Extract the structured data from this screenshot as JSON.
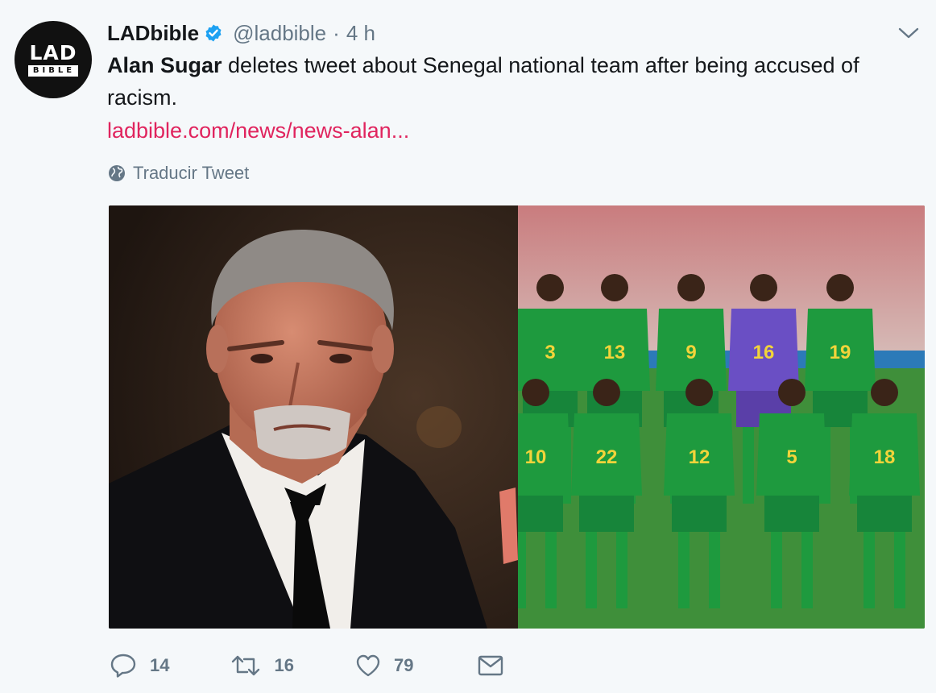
{
  "author": {
    "avatar_line1": "LAD",
    "avatar_line2": "BIBLE",
    "name": "LADbible",
    "handle": "@ladbible",
    "separator": "·",
    "time": "4 h"
  },
  "tweet": {
    "bold_text": "Alan Sugar",
    "text": " deletes tweet about Senegal national team after being accused of racism.",
    "link": "ladbible.com/news/news-alan...",
    "translate": "Traducir Tweet"
  },
  "jersey_numbers": [
    "3",
    "13",
    "9",
    "16",
    "19",
    "10",
    "22",
    "12",
    "5",
    "18"
  ],
  "actions": {
    "reply_count": "14",
    "retweet_count": "16",
    "like_count": "79"
  },
  "icons": {
    "verified": "verified-badge-icon",
    "caret": "chevron-down-icon",
    "globe": "globe-icon",
    "reply": "reply-icon",
    "retweet": "retweet-icon",
    "like": "heart-icon",
    "dm": "envelope-icon"
  },
  "colors": {
    "link": "#e0245e",
    "muted": "#657786",
    "verified": "#1da1f2",
    "background": "#f5f8fa"
  }
}
